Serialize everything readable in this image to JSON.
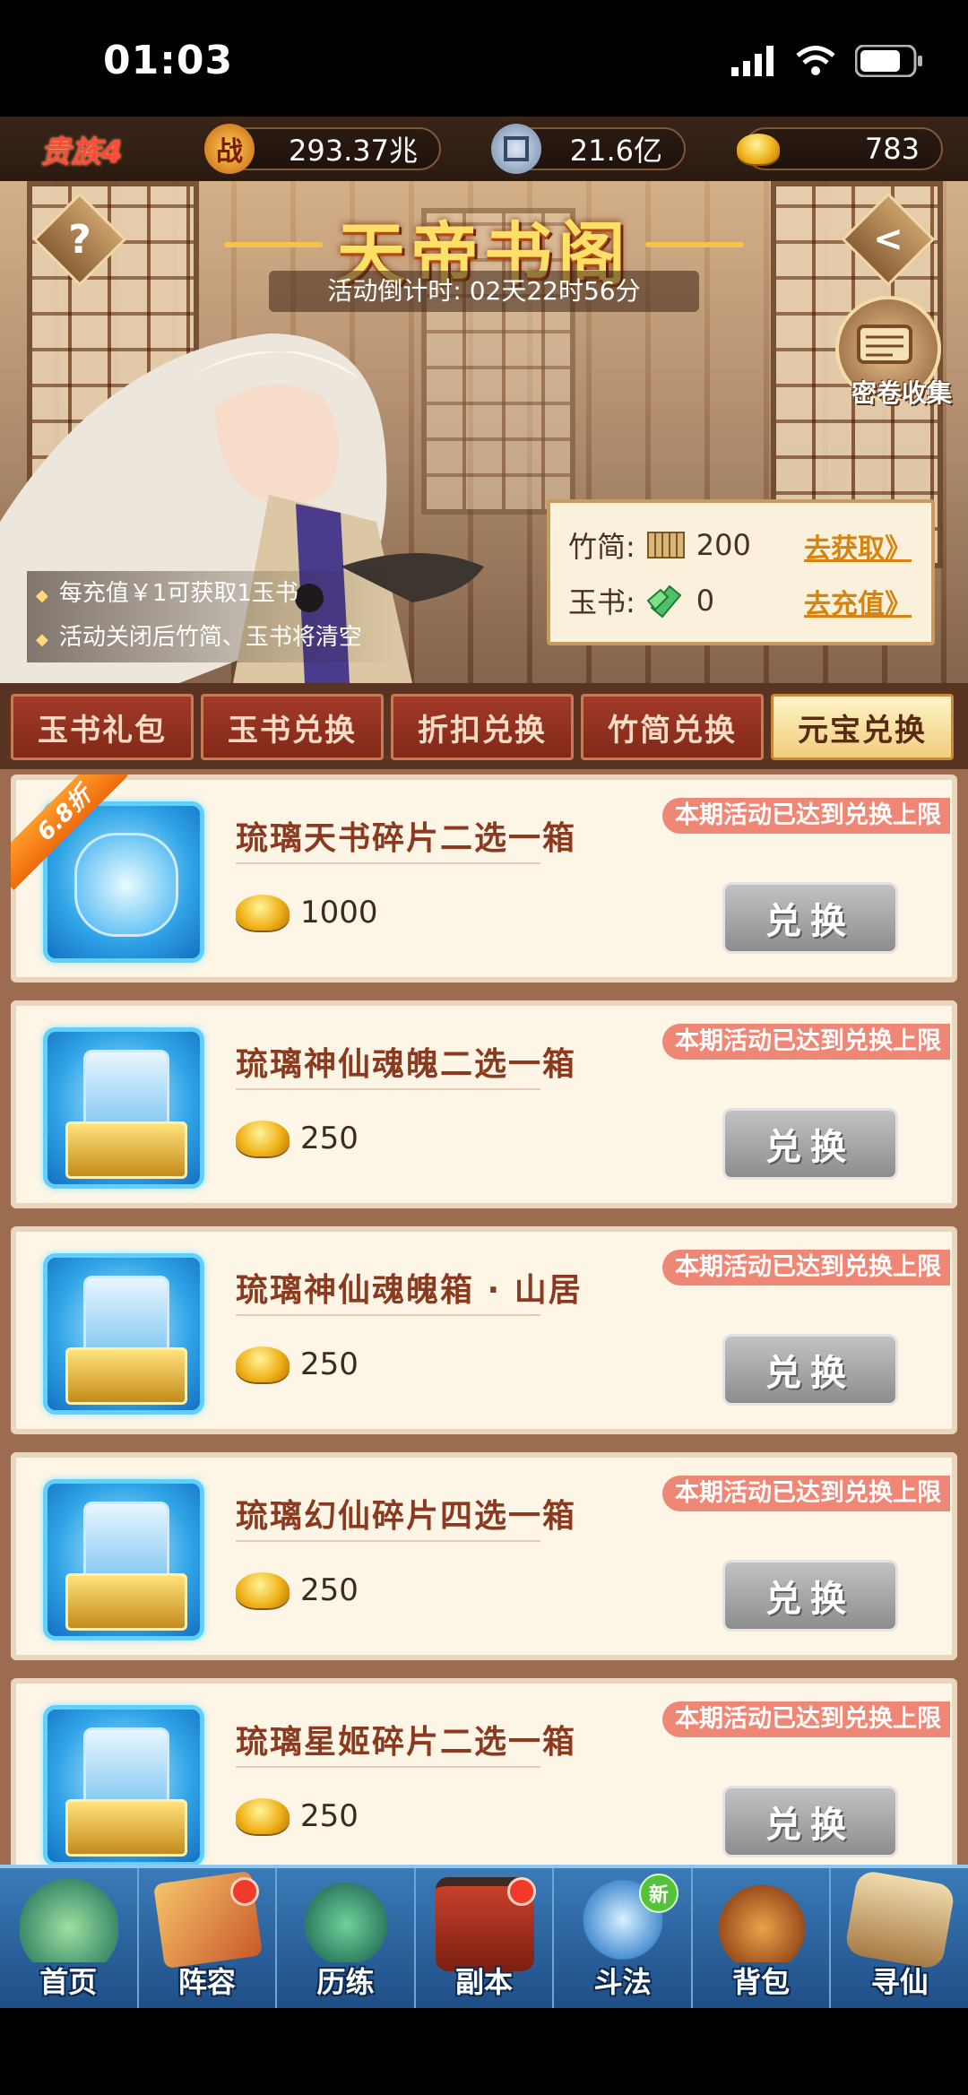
{
  "status_bar": {
    "time": "01:03"
  },
  "resources": {
    "rank": "贵族4",
    "power": "293.37兆",
    "coins": "21.6亿",
    "ingots": "783"
  },
  "banner": {
    "title": "天帝书阁",
    "countdown": "活动倒计时: 02天22时56分",
    "scroll_collect": "密卷收集",
    "notes": [
      "每充值￥1可获取1玉书",
      "活动关闭后竹简、玉书将清空"
    ],
    "bamboo_label": "竹简:",
    "bamboo_value": "200",
    "bamboo_link": "去获取》",
    "jade_label": "玉书:",
    "jade_value": "0",
    "jade_link": "去充值》"
  },
  "tabs": [
    "玉书礼包",
    "玉书兑换",
    "折扣兑换",
    "竹简兑换",
    "元宝兑换"
  ],
  "active_tab": 4,
  "items": [
    {
      "name": "琉璃天书碎片二选一箱",
      "price": "1000",
      "limit": "本期活动已达到兑换上限",
      "button": "兑换",
      "discount": "6.8折"
    },
    {
      "name": "琉璃神仙魂魄二选一箱",
      "price": "250",
      "limit": "本期活动已达到兑换上限",
      "button": "兑换"
    },
    {
      "name": "琉璃神仙魂魄箱 · 山居",
      "price": "250",
      "limit": "本期活动已达到兑换上限",
      "button": "兑换"
    },
    {
      "name": "琉璃幻仙碎片四选一箱",
      "price": "250",
      "limit": "本期活动已达到兑换上限",
      "button": "兑换"
    },
    {
      "name": "琉璃星姬碎片二选一箱",
      "price": "250",
      "limit": "本期活动已达到兑换上限",
      "button": "兑换"
    }
  ],
  "nav": [
    {
      "label": "首页"
    },
    {
      "label": "阵容",
      "badge": "dot"
    },
    {
      "label": "历练"
    },
    {
      "label": "副本",
      "badge": "dot"
    },
    {
      "label": "斗法",
      "badge": "新"
    },
    {
      "label": "背包"
    },
    {
      "label": "寻仙"
    }
  ]
}
